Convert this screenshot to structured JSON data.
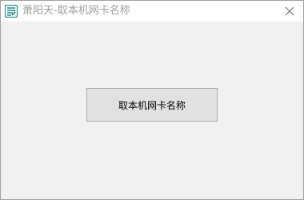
{
  "window": {
    "title": "萧阳天-取本机网卡名称",
    "icon": "app-logo-icon",
    "close_icon": "close-icon"
  },
  "main": {
    "button_label": "取本机网卡名称"
  },
  "colors": {
    "title_text": "#a0a0a0",
    "icon_teal": "#1a8a86",
    "client_bg": "#f0f0f0",
    "button_bg": "#e1e1e1",
    "button_border": "#adadad"
  }
}
